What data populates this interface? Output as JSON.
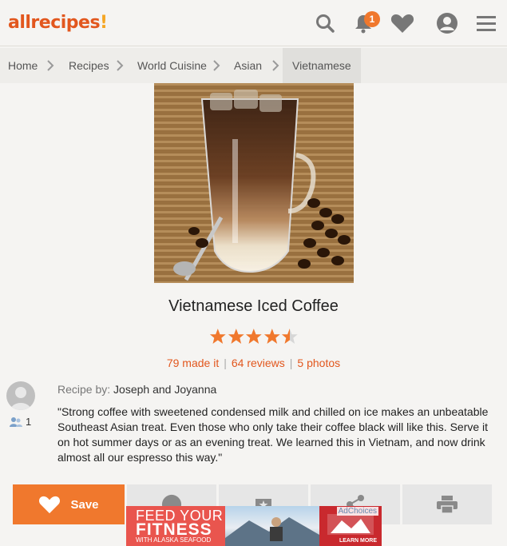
{
  "header": {
    "logo_text": "allrecipes",
    "logo_mark": "!",
    "notification_count": "1",
    "icons": [
      "search-icon",
      "bell-icon",
      "heart-icon",
      "user-icon",
      "menu-icon"
    ],
    "accent_color": "#f0782d"
  },
  "breadcrumb": {
    "items": [
      "Home",
      "Recipes",
      "World Cuisine",
      "Asian",
      "Vietnamese"
    ]
  },
  "recipe": {
    "title": "Vietnamese Iced Coffee",
    "rating": 4.5,
    "made_it": "79 made it",
    "reviews": "64 reviews",
    "photos": "5 photos",
    "by_label": "Recipe by:",
    "author": "Joseph and Joyanna",
    "made_count": "1",
    "description": "\"Strong coffee with sweetened condensed milk and chilled on ice makes an unbeatable Southeast Asian treat. Even those who only take their coffee black will like this. Serve it on hot summer days or as an evening treat. We learned this in Vietnam, and now drink almost all our espresso this way.\""
  },
  "actions": {
    "save_label": "Save",
    "buttons": [
      "heart-icon",
      "user-icon",
      "collection-icon",
      "share-icon",
      "print-icon"
    ]
  },
  "ad": {
    "line1": "FEED YOUR",
    "line2": "FITNESS",
    "line3": "WITH ALASKA SEAFOOD",
    "adchoices": "AdChoices",
    "cta": "LEARN MORE"
  }
}
